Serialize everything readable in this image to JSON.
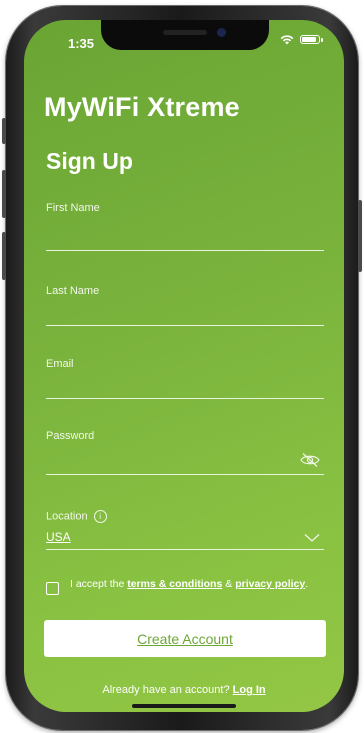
{
  "status_bar": {
    "time": "1:35"
  },
  "app": {
    "title": "MyWiFi Xtreme"
  },
  "page": {
    "title": "Sign Up"
  },
  "fields": {
    "first_name": {
      "label": "First Name",
      "value": ""
    },
    "last_name": {
      "label": "Last Name",
      "value": ""
    },
    "email": {
      "label": "Email",
      "value": ""
    },
    "password": {
      "label": "Password",
      "value": ""
    },
    "location": {
      "label": "Location",
      "value": "USA",
      "info_icon": "i"
    }
  },
  "terms": {
    "prefix": "I accept the",
    "terms_link": "terms & conditions",
    "joiner": "&",
    "privacy_link": "privacy policy",
    "suffix": "."
  },
  "buttons": {
    "create_account": "Create Account"
  },
  "footer": {
    "prompt": "Already have an account?",
    "login_link": "Log In"
  },
  "colors": {
    "accent": "#7ab43c",
    "button_text": "#6da736",
    "background_start": "#6aa534",
    "background_end": "#93c744"
  },
  "icons": {
    "password_toggle": "eye-off-icon",
    "location_dropdown": "chevron-down-icon",
    "location_info": "info-icon"
  }
}
